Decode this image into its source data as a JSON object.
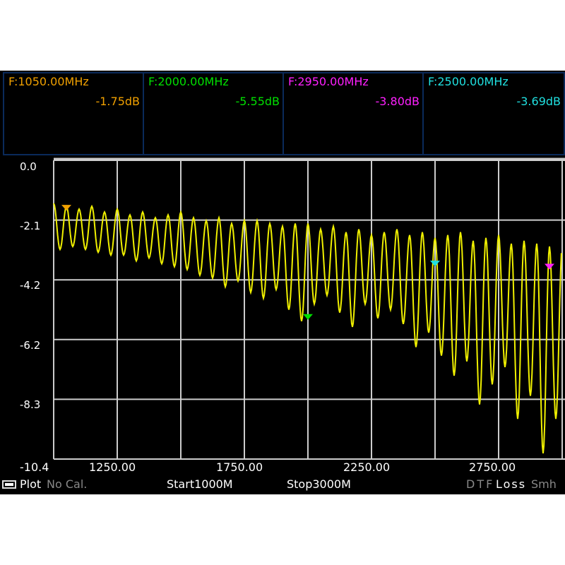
{
  "markers": [
    {
      "freq": "F:1050.00MHz",
      "value": "-1.75dB",
      "color": "#f0a000",
      "mhz": 1050,
      "db": -1.75
    },
    {
      "freq": "F:2000.00MHz",
      "value": "-5.55dB",
      "color": "#00e000",
      "mhz": 2000,
      "db": -5.55
    },
    {
      "freq": "F:2950.00MHz",
      "value": "-3.80dB",
      "color": "#ff20ff",
      "mhz": 2950,
      "db": -3.8
    },
    {
      "freq": "F:2500.00MHz",
      "value": "-3.69dB",
      "color": "#20e0e0",
      "mhz": 2500,
      "db": -3.69
    }
  ],
  "status": {
    "plot": "Plot",
    "cal": "No Cal.",
    "start": "Start1000M",
    "stop": "Stop3000M",
    "dtf": "DTF",
    "loss": "Loss",
    "smith": "Smh"
  },
  "chart_data": {
    "type": "line",
    "xlim": [
      1000,
      3000
    ],
    "ylim": [
      -10.4,
      0.0
    ],
    "yticks": [
      "0.0",
      "-2.1",
      "-4.2",
      "-6.2",
      "-8.3",
      "-10.4"
    ],
    "xticks": [
      "1250.00",
      "1750.00",
      "2250.00",
      "2750.00"
    ],
    "trace_color": "#f0f000",
    "ripple_period_mhz": 50,
    "peaks": [
      -1.5,
      -1.6,
      -1.7,
      -1.6,
      -1.8,
      -1.7,
      -1.9,
      -1.8,
      -2.0,
      -1.9,
      -1.8,
      -2.0,
      -2.1,
      -2.0,
      -2.2,
      -2.1,
      -2.1,
      -2.2,
      -2.3,
      -2.2,
      -2.2,
      -2.4,
      -2.3,
      -2.5,
      -2.4,
      -2.6,
      -2.5,
      -2.4,
      -2.6,
      -2.5,
      -2.7,
      -2.6,
      -2.5,
      -2.8,
      -2.7,
      -2.6,
      -2.9,
      -2.8,
      -2.9,
      -3.0
    ],
    "troughs": [
      -3.1,
      -3.0,
      -3.1,
      -3.2,
      -3.3,
      -3.3,
      -3.5,
      -3.4,
      -3.6,
      -3.7,
      -3.8,
      -4.0,
      -4.1,
      -4.4,
      -4.2,
      -4.6,
      -4.8,
      -4.5,
      -5.2,
      -5.6,
      -5.0,
      -4.7,
      -5.3,
      -5.8,
      -5.0,
      -5.5,
      -5.2,
      -5.7,
      -6.5,
      -6.0,
      -6.8,
      -7.5,
      -7.0,
      -8.5,
      -7.8,
      -7.2,
      -9.0,
      -8.2,
      -10.2,
      -9.0
    ]
  }
}
